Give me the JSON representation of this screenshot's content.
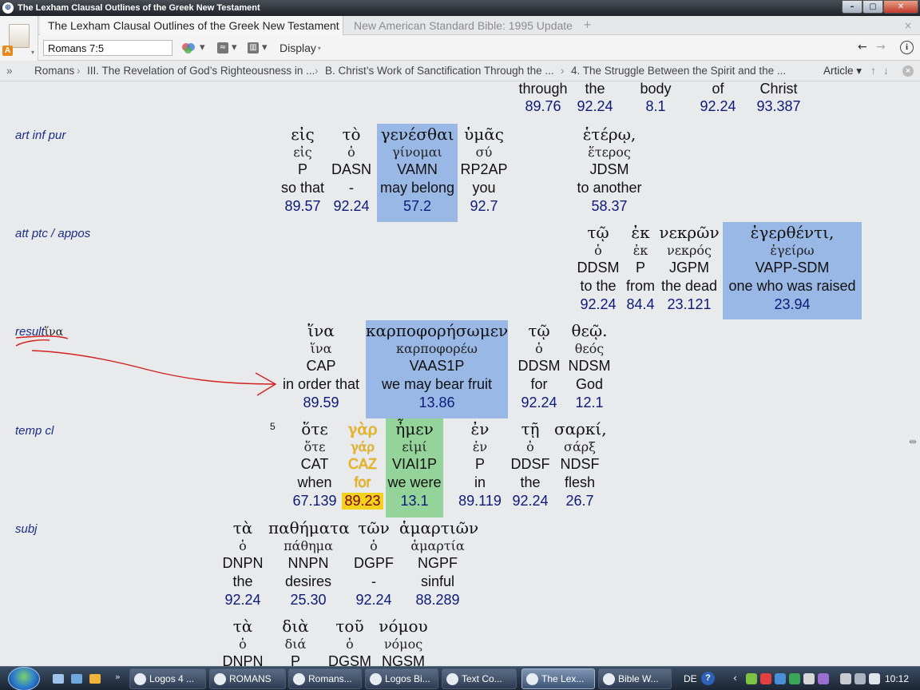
{
  "window": {
    "title": "The Lexham Clausal Outlines of the Greek New Testament",
    "min": "–",
    "max": "▢",
    "close": "✕"
  },
  "tabs": [
    {
      "label": "The Lexham Clausal Outlines of the Greek New Testament"
    },
    {
      "label": "New American Standard Bible: 1995 Update"
    }
  ],
  "tab_add": "+",
  "tab_close": "×",
  "logo_badge": "A",
  "toolbar": {
    "reference": "Romans 7:5",
    "display_label": "Display",
    "dropdown": "▾",
    "back": "←",
    "forward": "→",
    "info": "i",
    "link_glyph": "≈",
    "panel_glyph": "▥"
  },
  "breadcrumb": {
    "menu": "»",
    "sep": "›",
    "items": [
      "Romans",
      "III. The Revelation of God’s Righteousness in ...",
      "B. Christ’s Work of Sanctification Through the ...",
      "4. The Struggle Between the Spirit and the ..."
    ],
    "article": "Article ▾",
    "up": "↑",
    "down": "↓",
    "close": "×"
  },
  "labels": {
    "art_inf_pur": "art inf pur",
    "att_ptc_appos": "att ptc / appos",
    "result": "result",
    "result_greek": "ἵνα",
    "temp_cl": "temp cl",
    "subj": "subj"
  },
  "verse_number": "5",
  "scroll_grip": "⇹",
  "top_words": [
    {
      "m": "through",
      "n": "89.76"
    },
    {
      "m": "the",
      "n": "92.24"
    },
    {
      "m": "body",
      "n": "8.1"
    },
    {
      "m": "of",
      "n": "92.24"
    },
    {
      "m": "Christ",
      "n": "93.387"
    }
  ],
  "row_art_inf_pur": [
    {
      "g": "εἰς",
      "l": "εἰς",
      "m": "P",
      "t": "so that",
      "n": "89.57"
    },
    {
      "g": "τὸ",
      "l": "ὁ",
      "m": "DASN",
      "t": "-",
      "n": "92.24"
    },
    {
      "g": "γενέσθαι",
      "l": "γίνομαι",
      "m": "VAMN",
      "t": "may belong",
      "n": "57.2"
    },
    {
      "g": "ὑμᾶς",
      "l": "σύ",
      "m": "RP2AP",
      "t": "you",
      "n": "92.7"
    },
    {
      "g": "ἑτέρῳ,",
      "l": "ἕτερος",
      "m": "JDSM",
      "t": "to another",
      "n": "58.37"
    }
  ],
  "row_att_ptc": [
    {
      "g": "τῷ",
      "l": "ὁ",
      "m": "DDSM",
      "t": "to the",
      "n": "92.24"
    },
    {
      "g": "ἐκ",
      "l": "ἐκ",
      "m": "P",
      "t": "from",
      "n": "84.4"
    },
    {
      "g": "νεκρῶν",
      "l": "νεκρός",
      "m": "JGPM",
      "t": "the dead",
      "n": "23.121"
    },
    {
      "g": "ἐγερθέντι,",
      "l": "ἐγείρω",
      "m": "VAPP-SDM",
      "t": "one who was raised",
      "n": "23.94"
    }
  ],
  "row_result": [
    {
      "g": "ἵνα",
      "l": "ἵνα",
      "m": "CAP",
      "t": "in order that",
      "n": "89.59"
    },
    {
      "g": "καρποφορήσωμεν",
      "l": "καρποφορέω",
      "m": "VAAS1P",
      "t": "we may bear fruit",
      "n": "13.86"
    },
    {
      "g": "τῷ",
      "l": "ὁ",
      "m": "DDSM",
      "t": "for",
      "n": "92.24"
    },
    {
      "g": "θεῷ.",
      "l": "θεός",
      "m": "NDSM",
      "t": "God",
      "n": "12.1"
    }
  ],
  "row_temp": [
    {
      "g": "ὅτε",
      "l": "ὅτε",
      "m": "CAT",
      "t": "when",
      "n": "67.139"
    },
    {
      "g": "γὰρ",
      "l": "γάρ",
      "m": "CAZ",
      "t": "for",
      "n": "89.23"
    },
    {
      "g": "ἦμεν",
      "l": "εἰμί",
      "m": "VIAI1P",
      "t": "we were",
      "n": "13.1"
    },
    {
      "g": "ἐν",
      "l": "ἐν",
      "m": "P",
      "t": "in",
      "n": "89.119"
    },
    {
      "g": "τῇ",
      "l": "ὁ",
      "m": "DDSF",
      "t": "the",
      "n": "92.24"
    },
    {
      "g": "σαρκί,",
      "l": "σάρξ",
      "m": "NDSF",
      "t": "flesh",
      "n": "26.7"
    }
  ],
  "row_subj": [
    {
      "g": "τὰ",
      "l": "ὁ",
      "m": "DNPN",
      "t": "the",
      "n": "92.24"
    },
    {
      "g": "παθήματα",
      "l": "πάθημα",
      "m": "NNPN",
      "t": "desires",
      "n": "25.30"
    },
    {
      "g": "τῶν",
      "l": "ὁ",
      "m": "DGPF",
      "t": "-",
      "n": "92.24"
    },
    {
      "g": "ἁμαρτιῶν",
      "l": "ἁμαρτία",
      "m": "NGPF",
      "t": "sinful",
      "n": "88.289"
    }
  ],
  "row_next": [
    {
      "g": "τὰ",
      "l": "ὁ",
      "m": "DNPN"
    },
    {
      "g": "διὰ",
      "l": "διά",
      "m": "P"
    },
    {
      "g": "τοῦ",
      "l": "ὁ",
      "m": "DGSM"
    },
    {
      "g": "νόμου",
      "l": "νόμος",
      "m": "NGSM"
    }
  ],
  "taskbar": {
    "ql_more": "»",
    "buttons": [
      "Logos 4 ...",
      "ROMANS",
      "Romans...",
      "Logos Bi...",
      "Text Co...",
      "The Lex...",
      "Bible W..."
    ],
    "lang": "DE",
    "help": "?",
    "tray_more": "‹",
    "clock": "10:12"
  },
  "colors": {
    "highlight_blue": "#9ab8e6",
    "highlight_green": "#94d39a",
    "highlight_yellow": "#f2d21d",
    "label_blue": "#1a2d86",
    "ld_number": "#0e1a78",
    "annotation_red": "#d42020"
  }
}
